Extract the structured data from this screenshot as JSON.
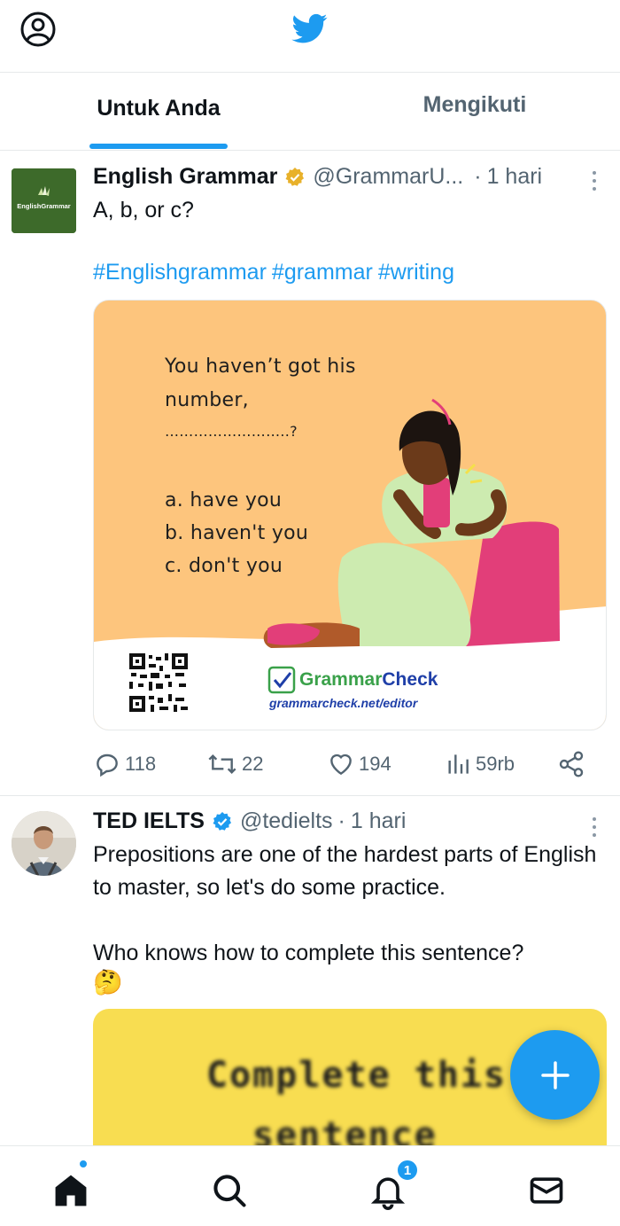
{
  "topbar": {
    "profile_icon": "profile-circle-icon",
    "logo_icon": "twitter-bird-icon",
    "brand_color": "#1d9bf0"
  },
  "tabs": [
    {
      "label": "Untuk Anda",
      "active": true
    },
    {
      "label": "Mengikuti",
      "active": false
    }
  ],
  "tweets": [
    {
      "name": "English Grammar",
      "verified": "gold",
      "handle": "@GrammarU...",
      "dot": "·",
      "time": "1 hari",
      "avatar_label": "EnglishGrammar",
      "text": "A, b, or c?",
      "hashtags": [
        "#Englishgrammar",
        "#grammar",
        "#writing"
      ],
      "media": {
        "question_line1": "You haven’t got his",
        "question_line2": "number,",
        "blank": "……………………..?",
        "option_a": "a. have you",
        "option_b": "b. haven't you",
        "option_c": "c. don't you",
        "brand_grammar": "Grammar",
        "brand_check": "Check",
        "brand_url": "grammarcheck.net/editor"
      },
      "stats": {
        "replies": "118",
        "retweets": "22",
        "likes": "194",
        "views": "59rb"
      }
    },
    {
      "name": "TED IELTS",
      "verified": "blue",
      "handle": "@tedielts",
      "dot": "·",
      "time": "1 hari",
      "text": "Prepositions are one of the hardest parts of English to master, so let's do some practice.\n\nWho knows how to complete this sentence?",
      "emoji": "🤔",
      "media": {
        "line1": "Complete this",
        "line2": "sentence"
      }
    }
  ],
  "fab": {
    "icon": "plus-icon"
  },
  "bottomnav": {
    "items": [
      "home-icon",
      "search-icon",
      "bell-icon",
      "mail-icon"
    ],
    "notification_count": "1"
  }
}
